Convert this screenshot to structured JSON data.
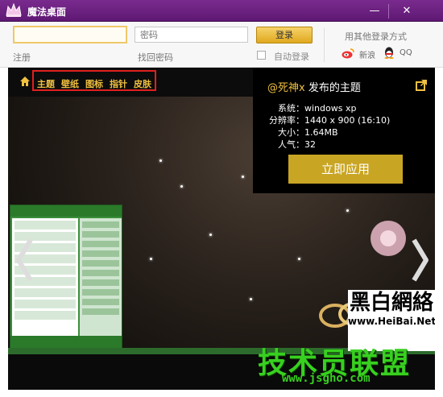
{
  "window": {
    "title": "魔法桌面",
    "minimize": "—",
    "close": "✕"
  },
  "login": {
    "username_value": "",
    "password_placeholder": "密码",
    "login_button": "登录",
    "register": "注册",
    "find_password": "找回密码",
    "auto_login": "自动登录",
    "other_methods": "用其他登录方式",
    "weibo": "新浪",
    "qq": "QQ"
  },
  "nav": {
    "items": [
      "主题",
      "壁纸",
      "图标",
      "指针",
      "皮肤"
    ]
  },
  "theme": {
    "author": "@死神x",
    "author_suffix": " 发布的主题",
    "system_label": "系统：",
    "system_value": "windows xp",
    "resolution_label": "分辨率：",
    "resolution_value": "1440 x 900 (16:10)",
    "size_label": "大小：",
    "size_value": "1.64MB",
    "popularity_label": "人气：",
    "popularity_value": "32",
    "apply_button": "立即应用"
  },
  "watermarks": {
    "brand_cn": "黑白網絡",
    "brand_url": "www.HeiBai.Net",
    "site_cn": "技术员联盟",
    "site_url": "www.jsgho.com"
  },
  "colors": {
    "titlebar": "#6a2080",
    "accent_gold": "#c9a524",
    "nav_text": "#f0c040",
    "nav_border": "#e02020",
    "watermark_green": "#38d020"
  }
}
